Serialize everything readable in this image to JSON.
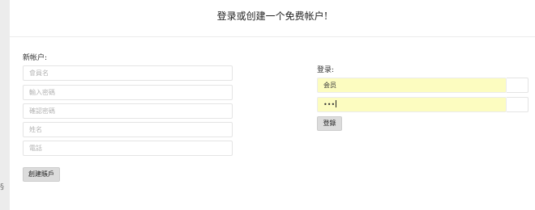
{
  "header": {
    "title": "登录或创建一个免费帐户!"
  },
  "register": {
    "section_label": "新帐户:",
    "fields": [
      {
        "placeholder": "會員名"
      },
      {
        "placeholder": "輸入密碼"
      },
      {
        "placeholder": "確認密碼"
      },
      {
        "placeholder": "姓名"
      },
      {
        "placeholder": "電話"
      }
    ],
    "submit_label": "創建賬戶"
  },
  "login": {
    "section_label": "登录:",
    "username_value": "会员",
    "password_value": "•••",
    "submit_label": "登錄"
  },
  "misc": {
    "side_glyph": "§"
  },
  "colors": {
    "autofill_bg": "#fcfcc0",
    "page_bg": "#ececec"
  }
}
